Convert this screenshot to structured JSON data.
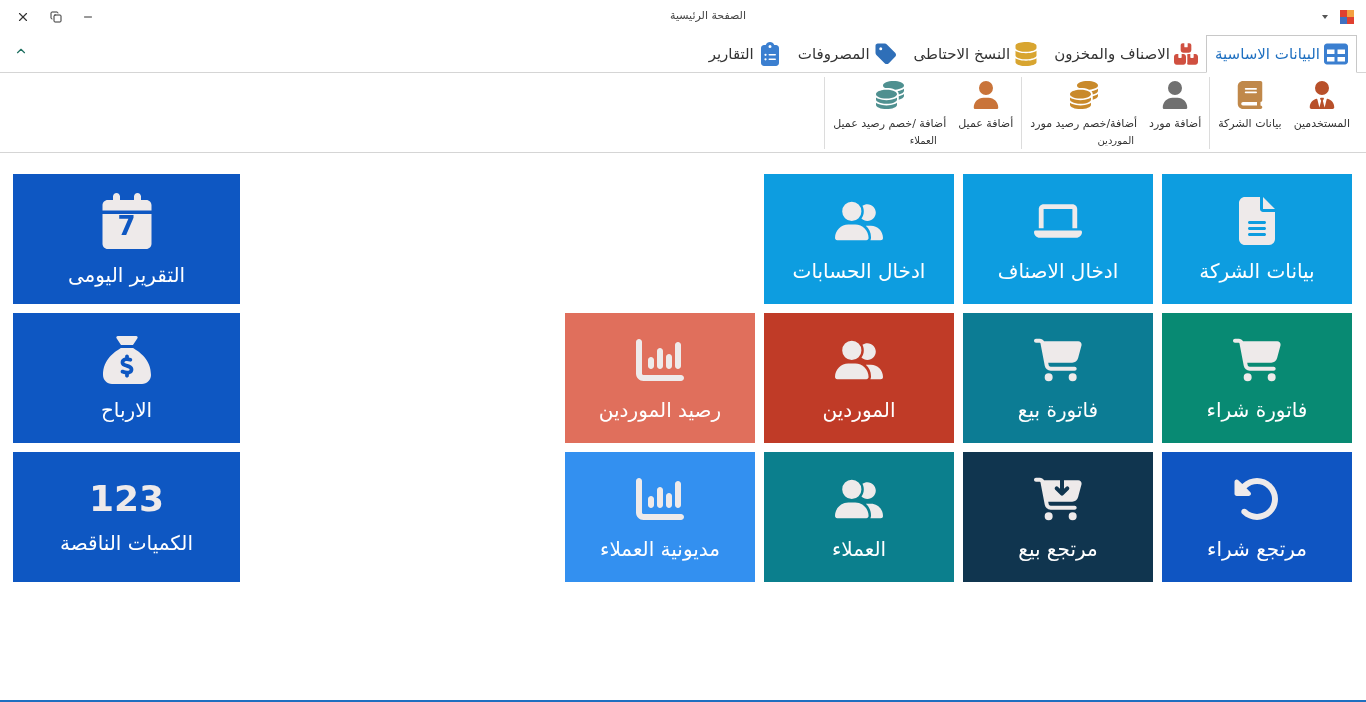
{
  "window": {
    "title": "الصفحة الرئيسية"
  },
  "tabs": [
    {
      "label": "البيانات الاساسية",
      "kind": "table",
      "selected": true
    },
    {
      "label": "الاصناف والمخزون",
      "kind": "stock",
      "selected": false
    },
    {
      "label": "النسخ الاحتاطى",
      "kind": "backup",
      "selected": false
    },
    {
      "label": "المصروفات",
      "kind": "tag",
      "selected": false
    },
    {
      "label": "التقارير",
      "kind": "clipboard",
      "selected": false
    }
  ],
  "ribbon_groups": [
    {
      "items": [
        {
          "label": "المستخدمين",
          "kind": "users"
        },
        {
          "label": "بيانات الشركة",
          "kind": "book"
        }
      ]
    },
    {
      "title": "الموردين",
      "items": [
        {
          "label": "أضافة مورد",
          "kind": "supplier"
        },
        {
          "label": "أضافة/خصم رصيد مورد",
          "kind": "coins"
        }
      ]
    },
    {
      "title": "العملاء",
      "items": [
        {
          "label": "أضافة عميل",
          "kind": "customer"
        },
        {
          "label": "أضافة /خصم رصيد عميل",
          "kind": "coins2"
        }
      ]
    }
  ],
  "tile_rows": [
    [
      {
        "label": "بيانات الشركة",
        "kind": "doc",
        "color": "#0d9de0"
      },
      {
        "label": "ادخال الاصناف",
        "kind": "laptop",
        "color": "#0d9de0"
      },
      {
        "label": "ادخال الحسابات",
        "kind": "users",
        "color": "#0d9de0"
      }
    ],
    [
      {
        "label": "فاتورة شراء",
        "kind": "cart",
        "color": "#088a73"
      },
      {
        "label": "فاتورة بيع",
        "kind": "cart",
        "color": "#0c7c94"
      },
      {
        "label": "الموردين",
        "kind": "users",
        "color": "#c03b27"
      },
      {
        "label": "رصيد الموردين",
        "kind": "chart",
        "color": "#e06f5c"
      }
    ],
    [
      {
        "label": "مرتجع شراء",
        "kind": "return",
        "color": "#0f55c2"
      },
      {
        "label": "مرتجع بيع",
        "kind": "upcart",
        "color": "#10354f"
      },
      {
        "label": "العملاء",
        "kind": "users",
        "color": "#0b7f8d"
      },
      {
        "label": "مديونية العملاء",
        "kind": "chart",
        "color": "#3390f0"
      }
    ]
  ],
  "side_tiles": [
    {
      "label": "التقرير اليومى",
      "kind": "calendar",
      "glyph": "7",
      "color": "#0e57c2"
    },
    {
      "label": "الارباح",
      "kind": "sack",
      "color": "#0e57c2"
    },
    {
      "label": "الكميات الناقصة",
      "kind": "numbers",
      "glyph": "123",
      "color": "#0e57c2"
    }
  ]
}
